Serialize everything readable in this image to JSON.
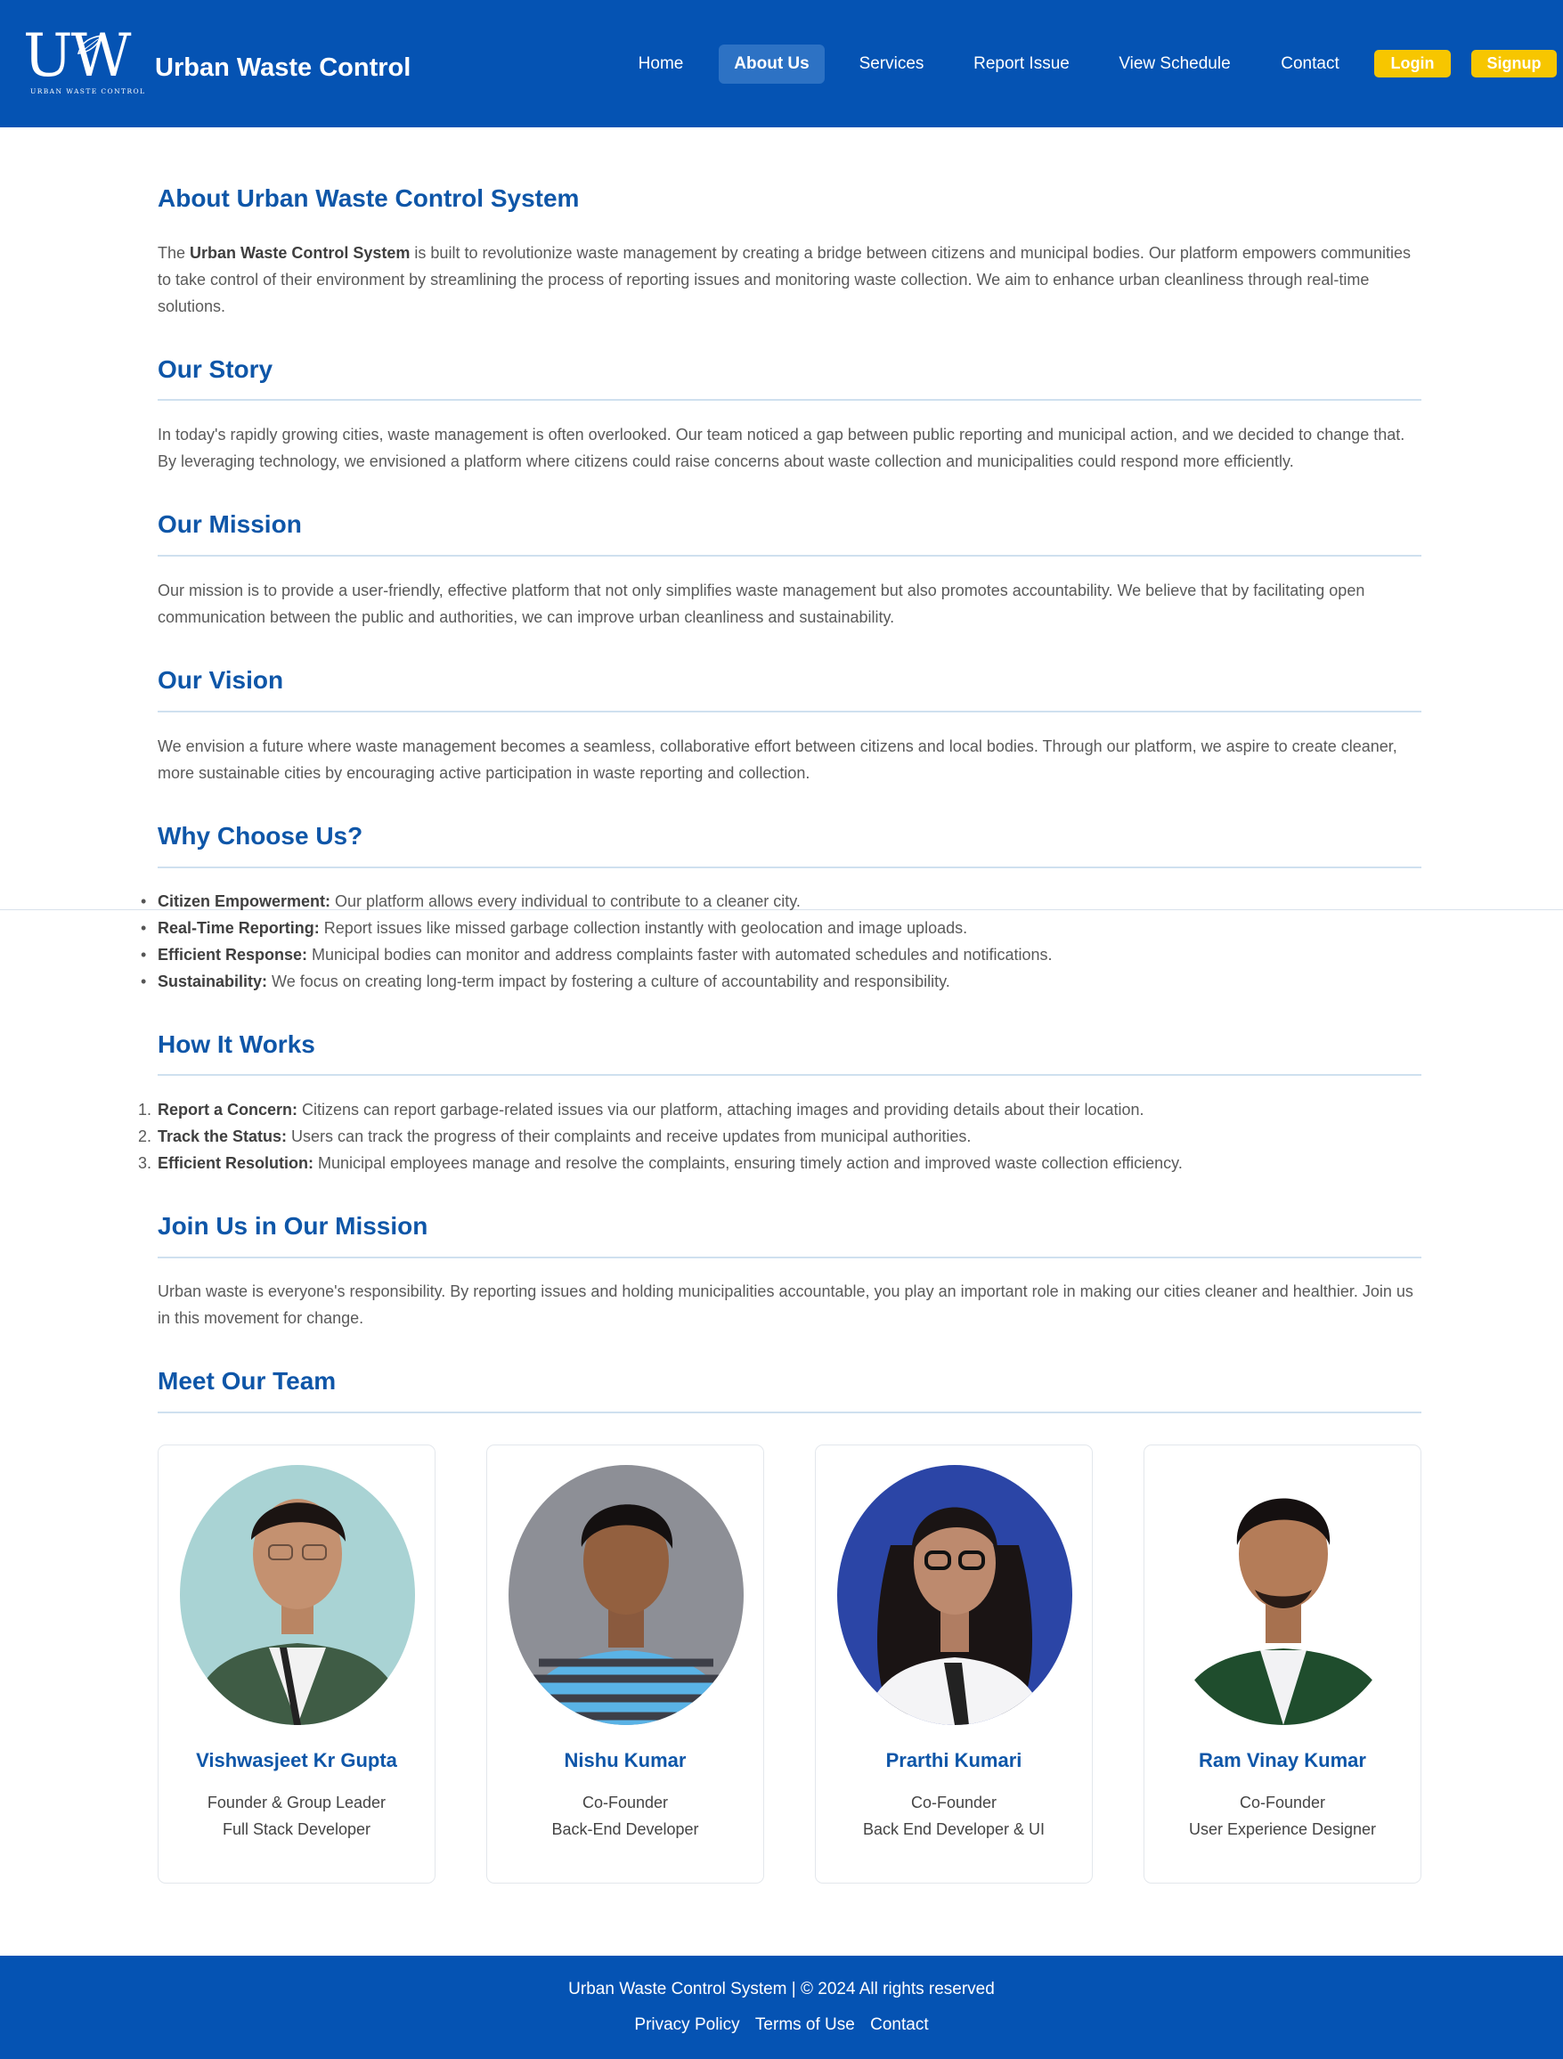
{
  "header": {
    "logo_text": "UW",
    "logo_subtext": "URBAN WASTE CONTROL",
    "brand": "Urban Waste Control",
    "nav": [
      {
        "label": "Home",
        "active": false
      },
      {
        "label": "About Us",
        "active": true
      },
      {
        "label": "Services",
        "active": false
      },
      {
        "label": "Report Issue",
        "active": false
      },
      {
        "label": "View Schedule",
        "active": false
      },
      {
        "label": "Contact",
        "active": false
      }
    ],
    "login_label": "Login",
    "signup_label": "Signup"
  },
  "about": {
    "title": "About Urban Waste Control System",
    "intro_prefix": "The ",
    "intro_bold": "Urban Waste Control System",
    "intro_rest": " is built to revolutionize waste management by creating a bridge between citizens and municipal bodies. Our platform empowers communities to take control of their environment by streamlining the process of reporting issues and monitoring waste collection. We aim to enhance urban cleanliness through real-time solutions."
  },
  "story": {
    "title": "Our Story",
    "text": "In today's rapidly growing cities, waste management is often overlooked. Our team noticed a gap between public reporting and municipal action, and we decided to change that. By leveraging technology, we envisioned a platform where citizens could raise concerns about waste collection and municipalities could respond more efficiently."
  },
  "mission": {
    "title": "Our Mission",
    "text": "Our mission is to provide a user-friendly, effective platform that not only simplifies waste management but also promotes accountability. We believe that by facilitating open communication between the public and authorities, we can improve urban cleanliness and sustainability."
  },
  "vision": {
    "title": "Our Vision",
    "text": "We envision a future where waste management becomes a seamless, collaborative effort between citizens and local bodies. Through our platform, we aspire to create cleaner, more sustainable cities by encouraging active participation in waste reporting and collection."
  },
  "why": {
    "title": "Why Choose Us?",
    "items": [
      {
        "bold": "Citizen Empowerment:",
        "text": " Our platform allows every individual to contribute to a cleaner city."
      },
      {
        "bold": "Real-Time Reporting:",
        "text": " Report issues like missed garbage collection instantly with geolocation and image uploads."
      },
      {
        "bold": "Efficient Response:",
        "text": " Municipal bodies can monitor and address complaints faster with automated schedules and notifications."
      },
      {
        "bold": "Sustainability:",
        "text": " We focus on creating long-term impact by fostering a culture of accountability and responsibility."
      }
    ]
  },
  "how": {
    "title": "How It Works",
    "steps": [
      {
        "num": "1.",
        "bold": "Report a Concern:",
        "text": " Citizens can report garbage-related issues via our platform, attaching images and providing details about their location."
      },
      {
        "num": "2.",
        "bold": "Track the Status:",
        "text": " Users can track the progress of their complaints and receive updates from municipal authorities."
      },
      {
        "num": "3.",
        "bold": "Efficient Resolution:",
        "text": " Municipal employees manage and resolve the complaints, ensuring timely action and improved waste collection efficiency."
      }
    ]
  },
  "join": {
    "title": "Join Us in Our Mission",
    "text": "Urban waste is everyone's responsibility. By reporting issues and holding municipalities accountable, you play an important role in making our cities cleaner and healthier. Join us in this movement for change."
  },
  "team": {
    "title": "Meet Our Team",
    "members": [
      {
        "name": "Vishwasjeet Kr Gupta",
        "role1": "Founder & Group Leader",
        "role2": "Full Stack Developer",
        "bg": "#a9d3d4"
      },
      {
        "name": "Nishu Kumar",
        "role1": "Co-Founder",
        "role2": "Back-End Developer",
        "bg": "#8d8f96"
      },
      {
        "name": "Prarthi Kumari",
        "role1": "Co-Founder",
        "role2": "Back End Developer & UI",
        "bg": "#2b45a6"
      },
      {
        "name": "Ram Vinay Kumar",
        "role1": "Co-Founder",
        "role2": "User Experience Designer",
        "bg": "#ffffff"
      }
    ]
  },
  "footer": {
    "copyright": "Urban Waste Control System | © 2024 All rights reserved",
    "links": [
      "Privacy Policy",
      "Terms of Use",
      "Contact"
    ]
  },
  "colors": {
    "primary": "#0553b3",
    "heading": "#0e56a8",
    "accent": "#f7c600"
  }
}
